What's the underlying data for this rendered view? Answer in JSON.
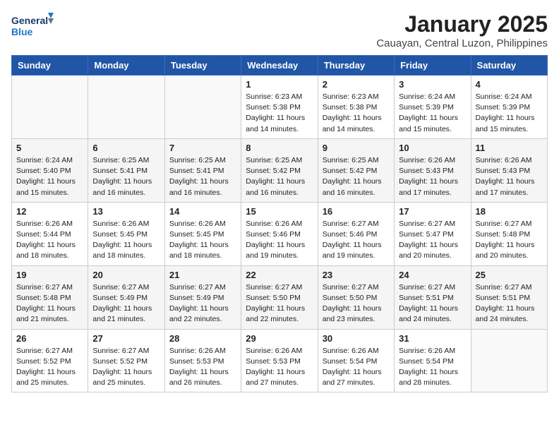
{
  "header": {
    "logo_line1": "General",
    "logo_line2": "Blue",
    "title": "January 2025",
    "subtitle": "Cauayan, Central Luzon, Philippines"
  },
  "weekdays": [
    "Sunday",
    "Monday",
    "Tuesday",
    "Wednesday",
    "Thursday",
    "Friday",
    "Saturday"
  ],
  "weeks": [
    [
      {
        "day": "",
        "info": ""
      },
      {
        "day": "",
        "info": ""
      },
      {
        "day": "",
        "info": ""
      },
      {
        "day": "1",
        "info": "Sunrise: 6:23 AM\nSunset: 5:38 PM\nDaylight: 11 hours\nand 14 minutes."
      },
      {
        "day": "2",
        "info": "Sunrise: 6:23 AM\nSunset: 5:38 PM\nDaylight: 11 hours\nand 14 minutes."
      },
      {
        "day": "3",
        "info": "Sunrise: 6:24 AM\nSunset: 5:39 PM\nDaylight: 11 hours\nand 15 minutes."
      },
      {
        "day": "4",
        "info": "Sunrise: 6:24 AM\nSunset: 5:39 PM\nDaylight: 11 hours\nand 15 minutes."
      }
    ],
    [
      {
        "day": "5",
        "info": "Sunrise: 6:24 AM\nSunset: 5:40 PM\nDaylight: 11 hours\nand 15 minutes."
      },
      {
        "day": "6",
        "info": "Sunrise: 6:25 AM\nSunset: 5:41 PM\nDaylight: 11 hours\nand 16 minutes."
      },
      {
        "day": "7",
        "info": "Sunrise: 6:25 AM\nSunset: 5:41 PM\nDaylight: 11 hours\nand 16 minutes."
      },
      {
        "day": "8",
        "info": "Sunrise: 6:25 AM\nSunset: 5:42 PM\nDaylight: 11 hours\nand 16 minutes."
      },
      {
        "day": "9",
        "info": "Sunrise: 6:25 AM\nSunset: 5:42 PM\nDaylight: 11 hours\nand 16 minutes."
      },
      {
        "day": "10",
        "info": "Sunrise: 6:26 AM\nSunset: 5:43 PM\nDaylight: 11 hours\nand 17 minutes."
      },
      {
        "day": "11",
        "info": "Sunrise: 6:26 AM\nSunset: 5:43 PM\nDaylight: 11 hours\nand 17 minutes."
      }
    ],
    [
      {
        "day": "12",
        "info": "Sunrise: 6:26 AM\nSunset: 5:44 PM\nDaylight: 11 hours\nand 18 minutes."
      },
      {
        "day": "13",
        "info": "Sunrise: 6:26 AM\nSunset: 5:45 PM\nDaylight: 11 hours\nand 18 minutes."
      },
      {
        "day": "14",
        "info": "Sunrise: 6:26 AM\nSunset: 5:45 PM\nDaylight: 11 hours\nand 18 minutes."
      },
      {
        "day": "15",
        "info": "Sunrise: 6:26 AM\nSunset: 5:46 PM\nDaylight: 11 hours\nand 19 minutes."
      },
      {
        "day": "16",
        "info": "Sunrise: 6:27 AM\nSunset: 5:46 PM\nDaylight: 11 hours\nand 19 minutes."
      },
      {
        "day": "17",
        "info": "Sunrise: 6:27 AM\nSunset: 5:47 PM\nDaylight: 11 hours\nand 20 minutes."
      },
      {
        "day": "18",
        "info": "Sunrise: 6:27 AM\nSunset: 5:48 PM\nDaylight: 11 hours\nand 20 minutes."
      }
    ],
    [
      {
        "day": "19",
        "info": "Sunrise: 6:27 AM\nSunset: 5:48 PM\nDaylight: 11 hours\nand 21 minutes."
      },
      {
        "day": "20",
        "info": "Sunrise: 6:27 AM\nSunset: 5:49 PM\nDaylight: 11 hours\nand 21 minutes."
      },
      {
        "day": "21",
        "info": "Sunrise: 6:27 AM\nSunset: 5:49 PM\nDaylight: 11 hours\nand 22 minutes."
      },
      {
        "day": "22",
        "info": "Sunrise: 6:27 AM\nSunset: 5:50 PM\nDaylight: 11 hours\nand 22 minutes."
      },
      {
        "day": "23",
        "info": "Sunrise: 6:27 AM\nSunset: 5:50 PM\nDaylight: 11 hours\nand 23 minutes."
      },
      {
        "day": "24",
        "info": "Sunrise: 6:27 AM\nSunset: 5:51 PM\nDaylight: 11 hours\nand 24 minutes."
      },
      {
        "day": "25",
        "info": "Sunrise: 6:27 AM\nSunset: 5:51 PM\nDaylight: 11 hours\nand 24 minutes."
      }
    ],
    [
      {
        "day": "26",
        "info": "Sunrise: 6:27 AM\nSunset: 5:52 PM\nDaylight: 11 hours\nand 25 minutes."
      },
      {
        "day": "27",
        "info": "Sunrise: 6:27 AM\nSunset: 5:52 PM\nDaylight: 11 hours\nand 25 minutes."
      },
      {
        "day": "28",
        "info": "Sunrise: 6:26 AM\nSunset: 5:53 PM\nDaylight: 11 hours\nand 26 minutes."
      },
      {
        "day": "29",
        "info": "Sunrise: 6:26 AM\nSunset: 5:53 PM\nDaylight: 11 hours\nand 27 minutes."
      },
      {
        "day": "30",
        "info": "Sunrise: 6:26 AM\nSunset: 5:54 PM\nDaylight: 11 hours\nand 27 minutes."
      },
      {
        "day": "31",
        "info": "Sunrise: 6:26 AM\nSunset: 5:54 PM\nDaylight: 11 hours\nand 28 minutes."
      },
      {
        "day": "",
        "info": ""
      }
    ]
  ]
}
